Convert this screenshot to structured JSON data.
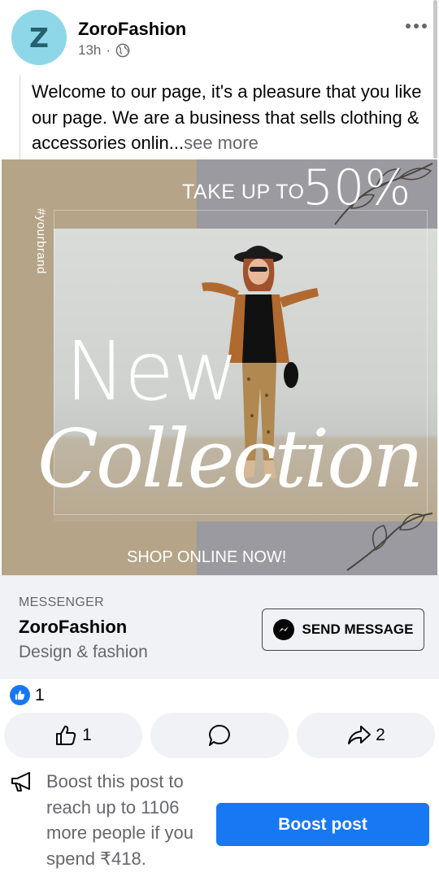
{
  "post": {
    "avatar_letter": "Z",
    "page_name": "ZoroFashion",
    "time": "13h",
    "separator": "·",
    "text": "Welcome to our page, it's a pleasure that you like our page. We are a business that sells clothing & accessories onlin...",
    "see_more": "see more"
  },
  "banner": {
    "take_up_to": "TAKE UP TO",
    "percent": "50%",
    "hashtag": "#yourbrand",
    "headline_1": "New",
    "headline_2": "Collection",
    "cta": "SHOP ONLINE NOW!"
  },
  "messenger": {
    "label": "MESSENGER",
    "title": "ZoroFashion",
    "subtitle": "Design & fashion",
    "button": "SEND MESSAGE"
  },
  "reactions": {
    "count": "1"
  },
  "actions": {
    "likes": "1",
    "shares": "2"
  },
  "boost": {
    "text": "Boost this post to reach up to 1106 more people if you spend ₹418.",
    "button": "Boost post"
  },
  "colors": {
    "accent": "#1877f2",
    "avatar_bg": "#8dd7e8",
    "banner_bg": "#b5a487"
  }
}
